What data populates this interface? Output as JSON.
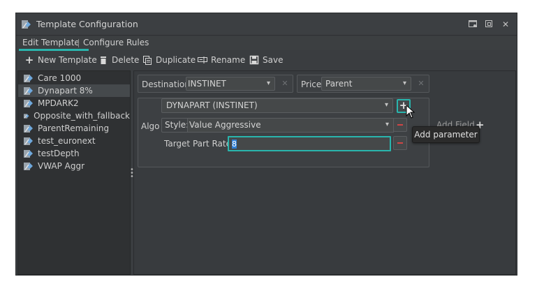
{
  "window": {
    "title": "Template Configuration"
  },
  "tabs": [
    {
      "label": "Edit Template",
      "active": true
    },
    {
      "label": "Configure Rules",
      "active": false
    }
  ],
  "toolbar": {
    "new_template": "New Template",
    "delete": "Delete",
    "duplicate": "Duplicate",
    "rename": "Rename",
    "save": "Save"
  },
  "templates": [
    {
      "name": "Care 1000",
      "selected": false
    },
    {
      "name": "Dynapart 8%",
      "selected": true
    },
    {
      "name": "MPDARK2",
      "selected": false
    },
    {
      "name": "Opposite_with_fallback",
      "selected": false
    },
    {
      "name": "ParentRemaining",
      "selected": false
    },
    {
      "name": "test_euronext",
      "selected": false
    },
    {
      "name": "testDepth",
      "selected": false
    },
    {
      "name": "VWAP Aggr",
      "selected": false
    }
  ],
  "destination": {
    "label": "Destination",
    "value": "INSTINET"
  },
  "price": {
    "label": "Price",
    "value": "Parent"
  },
  "algo": {
    "label": "Algo",
    "strategy_value": "DYNAPART (INSTINET)",
    "style_label": "Style:",
    "style_value": "Value Aggressive",
    "target_rate_label": "Target Part Rate:",
    "target_rate_value": "8"
  },
  "add_field": {
    "label": "Add Field"
  },
  "tooltip": {
    "text": "Add parameter"
  },
  "colors": {
    "accent": "#29b5ad",
    "remove": "#d04545",
    "background": "#3a3d40"
  },
  "icons": {
    "template": "template-icon",
    "plus": "plus-icon",
    "trash": "trash-icon",
    "duplicate": "duplicate-icon",
    "rename": "rename-icon",
    "save": "floppy-disk-icon"
  }
}
